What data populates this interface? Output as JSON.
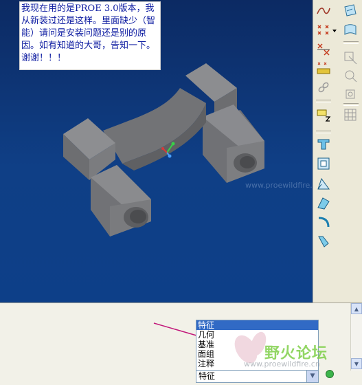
{
  "viewport": {
    "background_top": "#0c2a63",
    "background_bottom": "#0d3f88",
    "part_color": "#77787b",
    "watermark_url": "www.proewildfire.cn"
  },
  "toolbar": {
    "icons": [
      "sketch-curve-icon",
      "datum-plane-icon",
      "datum-point-icon",
      "datum-plane-alt-icon",
      "datum-axis-icon",
      "datum-axis-alt-icon",
      "datum-coordinate-icon",
      "datum-point-offset-icon",
      "datum-chain-icon",
      "datum-csys-icon",
      "annotation-icon",
      "grid-icon",
      "extrude-icon",
      "shell-icon",
      "round-icon",
      "draft-icon",
      "rib-icon",
      "sweep-icon"
    ]
  },
  "note": {
    "text": "我现在用的是PROE 3.0版本，我从新装过还是这样。里面缺少（智能）请问是安装问题还是别的原因。如有知道的大哥，告知一下。谢谢！！！"
  },
  "filter": {
    "options": [
      "特征",
      "几何",
      "基准",
      "面组",
      "注释"
    ],
    "selected_index": 0,
    "current_value": "特征"
  },
  "watermark": {
    "title": "野火论坛",
    "url": "www.proewildfire.cn"
  }
}
